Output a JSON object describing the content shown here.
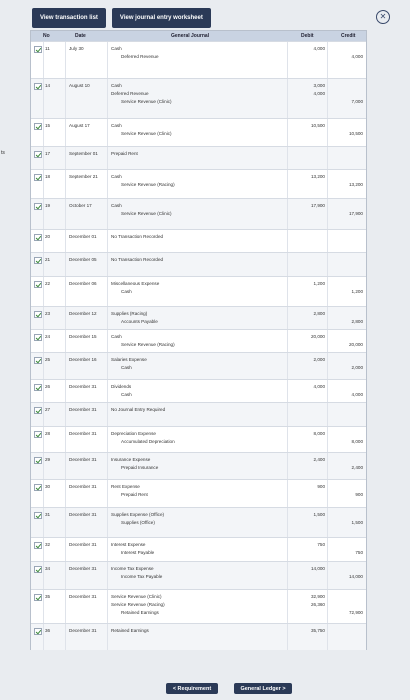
{
  "tabs": [
    "View transaction list",
    "View journal entry worksheet"
  ],
  "close_icon": "close-icon",
  "header": {
    "no": "No",
    "date": "Date",
    "general_journal": "General Journal",
    "debit": "Debit",
    "credit": "Credit"
  },
  "edge_text": "ts",
  "rows": [
    {
      "no": "11",
      "date": "July 30",
      "lines": [
        {
          "acct": "Cash",
          "debit": "4,000",
          "credit": ""
        },
        {
          "acct": "Deferred Revenue",
          "debit": "",
          "credit": "4,000",
          "indent": true
        }
      ]
    },
    {
      "no": "14",
      "date": "August 10",
      "lines": [
        {
          "acct": "Cash",
          "debit": "3,000",
          "credit": ""
        },
        {
          "acct": "Deferred Revenue",
          "debit": "4,000",
          "credit": ""
        },
        {
          "acct": "Service Revenue (Clinic)",
          "debit": "",
          "credit": "7,000",
          "indent": true
        }
      ]
    },
    {
      "no": "15",
      "date": "August 17",
      "lines": [
        {
          "acct": "Cash",
          "debit": "10,500",
          "credit": ""
        },
        {
          "acct": "Service Revenue (Clinic)",
          "debit": "",
          "credit": "10,500",
          "indent": true
        }
      ]
    },
    {
      "no": "17",
      "date": "September 01",
      "lines": [
        {
          "acct": "Prepaid Rent",
          "debit": "",
          "credit": ""
        }
      ]
    },
    {
      "no": "18",
      "date": "September 21",
      "lines": [
        {
          "acct": "Cash",
          "debit": "13,200",
          "credit": ""
        },
        {
          "acct": "Service Revenue (Racing)",
          "debit": "",
          "credit": "13,200",
          "indent": true
        }
      ]
    },
    {
      "no": "19",
      "date": "October 17",
      "lines": [
        {
          "acct": "Cash",
          "debit": "17,900",
          "credit": ""
        },
        {
          "acct": "Service Revenue (Clinic)",
          "debit": "",
          "credit": "17,900",
          "indent": true
        }
      ]
    },
    {
      "no": "20",
      "date": "December 01",
      "lines": [
        {
          "acct": "No Transaction Recorded",
          "debit": "",
          "credit": ""
        }
      ]
    },
    {
      "no": "21",
      "date": "December 05",
      "lines": [
        {
          "acct": "No Transaction Recorded",
          "debit": "",
          "credit": ""
        }
      ]
    },
    {
      "no": "22",
      "date": "December 06",
      "lines": [
        {
          "acct": "Miscellaneous Expense",
          "debit": "1,200",
          "credit": ""
        },
        {
          "acct": "Cash",
          "debit": "",
          "credit": "1,200",
          "indent": true
        }
      ]
    },
    {
      "no": "23",
      "date": "December 12",
      "lines": [
        {
          "acct": "Supplies (Racing)",
          "debit": "2,800",
          "credit": ""
        },
        {
          "acct": "Accounts Payable",
          "debit": "",
          "credit": "2,800",
          "indent": true
        }
      ]
    },
    {
      "no": "24",
      "date": "December 15",
      "lines": [
        {
          "acct": "Cash",
          "debit": "20,000",
          "credit": ""
        },
        {
          "acct": "Service Revenue (Racing)",
          "debit": "",
          "credit": "20,000",
          "indent": true
        }
      ]
    },
    {
      "no": "25",
      "date": "December 16",
      "lines": [
        {
          "acct": "Salaries Expense",
          "debit": "2,000",
          "credit": ""
        },
        {
          "acct": "Cash",
          "debit": "",
          "credit": "2,000",
          "indent": true
        }
      ]
    },
    {
      "no": "26",
      "date": "December 31",
      "lines": [
        {
          "acct": "Dividends",
          "debit": "4,000",
          "credit": ""
        },
        {
          "acct": "Cash",
          "debit": "",
          "credit": "4,000",
          "indent": true
        }
      ]
    },
    {
      "no": "27",
      "date": "December 31",
      "lines": [
        {
          "acct": "No Journal Entry Required",
          "debit": "",
          "credit": ""
        }
      ]
    },
    {
      "no": "28",
      "date": "December 31",
      "lines": [
        {
          "acct": "Depreciation Expense",
          "debit": "8,000",
          "credit": ""
        },
        {
          "acct": "Accumulated Depreciation",
          "debit": "",
          "credit": "8,000",
          "indent": true
        }
      ]
    },
    {
      "no": "29",
      "date": "December 31",
      "lines": [
        {
          "acct": "Insurance Expense",
          "debit": "2,400",
          "credit": ""
        },
        {
          "acct": "Prepaid Insurance",
          "debit": "",
          "credit": "2,400",
          "indent": true
        }
      ]
    },
    {
      "no": "30",
      "date": "December 31",
      "lines": [
        {
          "acct": "Rent Expense",
          "debit": "900",
          "credit": ""
        },
        {
          "acct": "Prepaid Rent",
          "debit": "",
          "credit": "900",
          "indent": true
        }
      ]
    },
    {
      "no": "31",
      "date": "December 31",
      "lines": [
        {
          "acct": "Supplies Expense (Office)",
          "debit": "1,500",
          "credit": ""
        },
        {
          "acct": "Supplies (Office)",
          "debit": "",
          "credit": "1,500",
          "indent": true
        }
      ]
    },
    {
      "no": "32",
      "date": "December 31",
      "lines": [
        {
          "acct": "Interest Expense",
          "debit": "750",
          "credit": ""
        },
        {
          "acct": "Interest Payable",
          "debit": "",
          "credit": "750",
          "indent": true
        }
      ]
    },
    {
      "no": "34",
      "date": "December 31",
      "lines": [
        {
          "acct": "Income Tax Expense",
          "debit": "14,000",
          "credit": ""
        },
        {
          "acct": "Income Tax Payable",
          "debit": "",
          "credit": "14,000",
          "indent": true
        }
      ]
    },
    {
      "no": "35",
      "date": "December 31",
      "lines": [
        {
          "acct": "Service Revenue (Clinic)",
          "debit": "32,900",
          "credit": ""
        },
        {
          "acct": "Service Revenue (Racing)",
          "debit": "26,360",
          "credit": ""
        },
        {
          "acct": "Retained Earnings",
          "debit": "",
          "credit": "72,900",
          "indent": true
        }
      ]
    },
    {
      "no": "36",
      "date": "December 31",
      "lines": [
        {
          "acct": "Retained Earnings",
          "debit": "35,750",
          "credit": ""
        }
      ]
    }
  ],
  "bottom": {
    "prev": "< Requirement",
    "next": "General Ledger >"
  }
}
